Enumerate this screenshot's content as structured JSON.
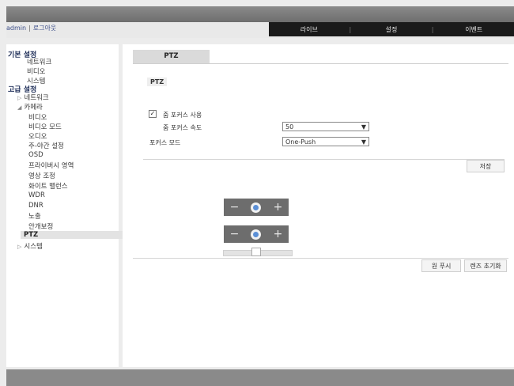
{
  "header": {
    "user": "admin",
    "logout": "로그아웃",
    "nav": [
      "라이브",
      "설정",
      "이벤트"
    ]
  },
  "sidebar": {
    "basic_title": "기본 설정",
    "basic_items": [
      "네트워크",
      "비디오",
      "시스템"
    ],
    "advanced_title": "고급 설정",
    "adv_network": "네트워크",
    "adv_camera": "카메라",
    "camera_items": [
      "비디오",
      "비디오 모드",
      "오디오",
      "주-야간 설정",
      "OSD",
      "프라이버시 영역",
      "영상 조정",
      "화이트 밸런스",
      "WDR",
      "DNR",
      "노출",
      "안개보정",
      "PTZ"
    ],
    "adv_system": "시스템"
  },
  "main": {
    "tab": "PTZ",
    "section_title": "PTZ",
    "zoom_focus_enable_label": "줌 포커스 사용",
    "zoom_focus_enabled": true,
    "zoom_focus_speed_label": "줌 포커스 속도",
    "zoom_focus_speed_value": "50",
    "focus_mode_label": "포커스 모드",
    "focus_mode_value": "One-Push",
    "save_button": "저장",
    "one_push_button": "원 푸시",
    "lens_init_button": "렌즈 초기화",
    "zoom_slider_level": 0.45
  },
  "icons": {
    "checkbox_checked": "✓",
    "dropdown": "chevron-down-icon",
    "minus": "minus-icon",
    "plus": "plus-icon",
    "zoom": "zoom-icon",
    "focus": "focus-icon"
  }
}
